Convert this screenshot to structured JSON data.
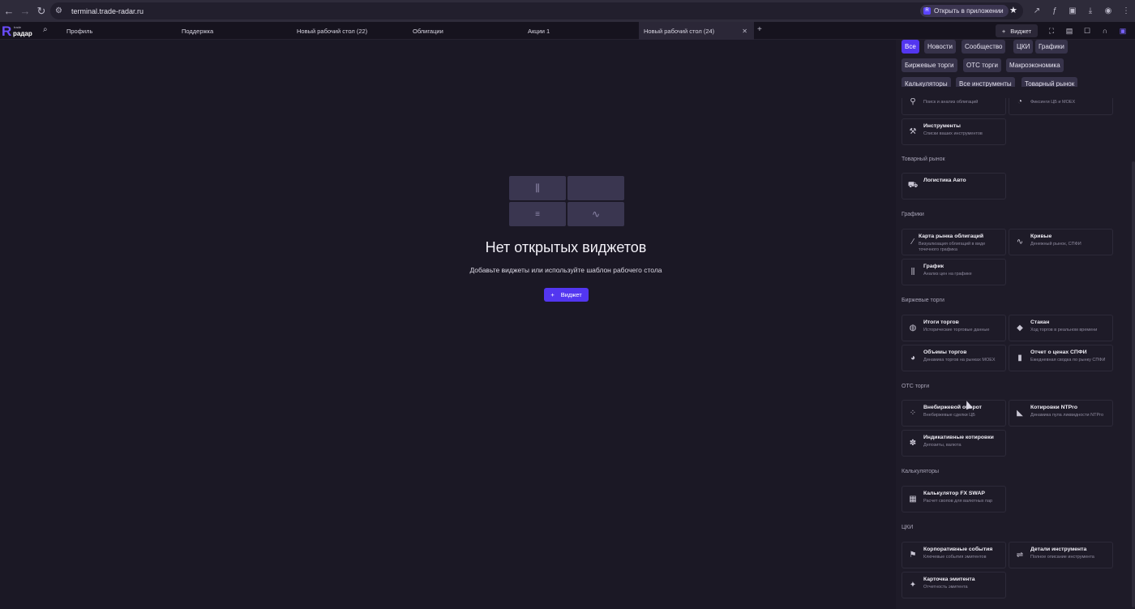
{
  "browser": {
    "url": "terminal.trade-radar.ru",
    "open_in_app": "Открыть в приложении"
  },
  "header": {
    "logo_text": "радар",
    "logo_small": "trade",
    "tabs": [
      {
        "label": "Профиль"
      },
      {
        "label": "Поддержка"
      },
      {
        "label": "Новый рабочий стол (22)"
      },
      {
        "label": "Облигации"
      },
      {
        "label": "Акции 1"
      },
      {
        "label": "Новый рабочий стол (24)"
      }
    ],
    "widget_button": "Виджет"
  },
  "main": {
    "empty_title": "Нет открытых виджетов",
    "empty_subtitle": "Добавьте виджеты или используйте шаблон рабочего стола",
    "add_widget_button": "Виджет"
  },
  "panel": {
    "filters": [
      {
        "label": "Все"
      },
      {
        "label": "Новости"
      },
      {
        "label": "Сообщество"
      },
      {
        "label": "ЦКИ"
      },
      {
        "label": "Графики"
      },
      {
        "label": "Биржевые торги"
      },
      {
        "label": "OTC торги"
      },
      {
        "label": "Макроэкономика"
      },
      {
        "label": "Калькуляторы"
      },
      {
        "label": "Все инструменты"
      },
      {
        "label": "Товарный рынок"
      }
    ],
    "top_cards": [
      {
        "desc": "Поиск и анализ облигаций"
      },
      {
        "desc": "Фиксинги ЦБ и MOEX"
      }
    ],
    "instruments_card": {
      "title": "Инструменты",
      "desc": "Списки ваших инструментов"
    },
    "sections": {
      "commodity": "Товарный рынок",
      "charts": "Графики",
      "exchange": "Биржевые торги",
      "otc": "OTC торги",
      "calculators": "Калькуляторы",
      "cki": "ЦКИ"
    },
    "cards": {
      "logistics": {
        "title": "Логистика Авто",
        "desc": ""
      },
      "bond_map": {
        "title": "Карта рынка облигаций",
        "desc": "Визуализация облигаций в виде точечного графика"
      },
      "curves": {
        "title": "Кривые",
        "desc": "Денежный рынок, СПФИ"
      },
      "chart": {
        "title": "График",
        "desc": "Анализ цен на графике"
      },
      "results": {
        "title": "Итоги торгов",
        "desc": "Исторические торговые данные"
      },
      "orderbook": {
        "title": "Стакан",
        "desc": "Ход торгов в реальном времени"
      },
      "volumes": {
        "title": "Объемы торгов",
        "desc": "Динамика торгов на рынках MOEX"
      },
      "spfi_report": {
        "title": "Отчет о ценах СПФИ",
        "desc": "Ежедневная сводка по рынку СПФИ"
      },
      "otc_turnover": {
        "title": "Внебиржевой оборот",
        "desc": "Внебиржевые сделки ЦБ"
      },
      "ntpro": {
        "title": "Котировки NTPro",
        "desc": "Динамика пула ликвидности NTPro"
      },
      "indicative": {
        "title": "Индикативные котировки",
        "desc": "Депозиты, валюта"
      },
      "fx_swap": {
        "title": "Калькулятор FX SWAP",
        "desc": "Расчет свопов для валютных пар"
      },
      "corp_events": {
        "title": "Корпоративные события",
        "desc": "Ключевые события эмитентов"
      },
      "instrument_details": {
        "title": "Детали инструмента",
        "desc": "Полное описание инструмента"
      },
      "issuer_card": {
        "title": "Карточка эмитента",
        "desc": "Отчетность эмитента"
      }
    }
  },
  "colors": {
    "accent": "#5336f0",
    "background": "#1b1825",
    "panel": "#1e1b28"
  }
}
